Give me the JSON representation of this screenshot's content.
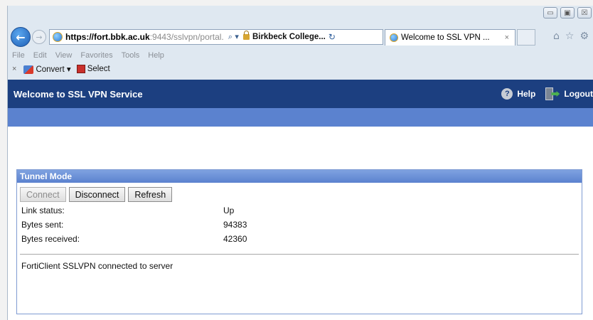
{
  "browser": {
    "url_scheme": "https://fort.",
    "url_host": "bbk.ac.uk",
    "url_rest": ":9443/sslvpn/portal.",
    "cert_label": "Birkbeck College...",
    "tab_title": "Welcome to SSL VPN ...",
    "tab_close": "×",
    "menu": [
      "File",
      "Edit",
      "View",
      "Favorites",
      "Tools",
      "Help"
    ],
    "command_bar": {
      "close": "×",
      "convert_label": "Convert",
      "convert_arrow": "▾",
      "select_label": "Select"
    },
    "window_controls": [
      "▭",
      "▣",
      "☒"
    ]
  },
  "page": {
    "header_title": "Welcome to SSL VPN Service",
    "help_label": "Help",
    "logout_label": "Logout",
    "panel_title": "Tunnel Mode",
    "buttons": {
      "connect": "Connect",
      "disconnect": "Disconnect",
      "refresh": "Refresh"
    },
    "info": [
      {
        "label": "Link status:",
        "value": "Up"
      },
      {
        "label": "Bytes sent:",
        "value": "94383"
      },
      {
        "label": "Bytes received:",
        "value": "42360"
      }
    ],
    "status_message": "FortiClient SSLVPN connected to server"
  }
}
